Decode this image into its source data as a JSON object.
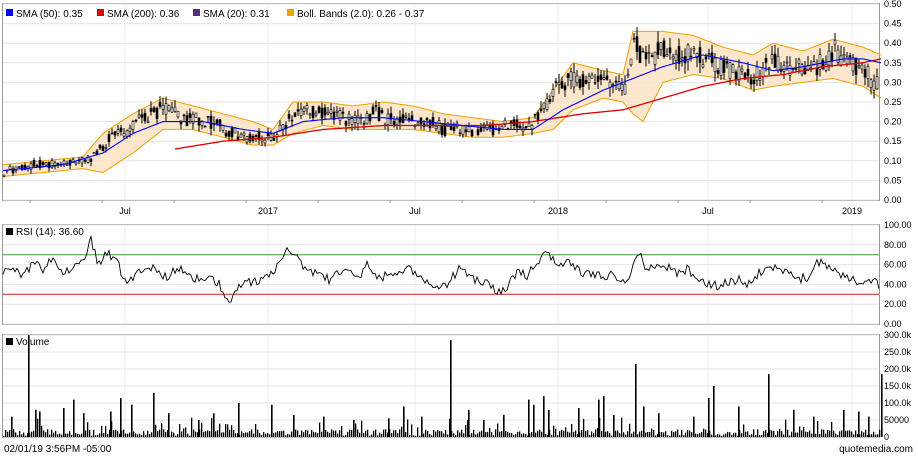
{
  "chart_data": [
    {
      "type": "candlestick",
      "panel": "price",
      "legend": [
        {
          "label": "SMA (50): 0.35",
          "color": "#0000ff"
        },
        {
          "label": "SMA (200): 0.36",
          "color": "#dd0000"
        },
        {
          "label": "SMA (20): 0.31",
          "color": "#5a2d82"
        },
        {
          "label": "Boll. Bands (2.0): 0.26 - 0.37",
          "color": "#f0a000"
        }
      ],
      "ylim": [
        0,
        0.5
      ],
      "yticks": [
        "0.50",
        "0.45",
        "0.40",
        "0.35",
        "0.30",
        "0.25",
        "0.20",
        "0.15",
        "0.10",
        "0.05",
        "0.00"
      ],
      "xticks": [
        "Jul",
        "2017",
        "Jul",
        "2018",
        "Jul",
        "2019"
      ],
      "grid": true,
      "price_path": [
        [
          0,
          0.07
        ],
        [
          15,
          0.085
        ],
        [
          30,
          0.09
        ],
        [
          45,
          0.09
        ],
        [
          60,
          0.1
        ],
        [
          75,
          0.1
        ],
        [
          90,
          0.11
        ],
        [
          100,
          0.14
        ],
        [
          110,
          0.17
        ],
        [
          120,
          0.17
        ],
        [
          130,
          0.19
        ],
        [
          140,
          0.21
        ],
        [
          150,
          0.22
        ],
        [
          160,
          0.24
        ],
        [
          170,
          0.22
        ],
        [
          180,
          0.2
        ],
        [
          190,
          0.21
        ],
        [
          200,
          0.2
        ],
        [
          210,
          0.2
        ],
        [
          220,
          0.18
        ],
        [
          230,
          0.17
        ],
        [
          240,
          0.16
        ],
        [
          250,
          0.16
        ],
        [
          260,
          0.16
        ],
        [
          270,
          0.16
        ],
        [
          280,
          0.19
        ],
        [
          290,
          0.22
        ],
        [
          300,
          0.24
        ],
        [
          310,
          0.22
        ],
        [
          320,
          0.22
        ],
        [
          330,
          0.21
        ],
        [
          340,
          0.21
        ],
        [
          350,
          0.2
        ],
        [
          360,
          0.2
        ],
        [
          370,
          0.23
        ],
        [
          380,
          0.21
        ],
        [
          390,
          0.2
        ],
        [
          400,
          0.21
        ],
        [
          410,
          0.2
        ],
        [
          420,
          0.2
        ],
        [
          430,
          0.2
        ],
        [
          440,
          0.18
        ],
        [
          450,
          0.18
        ],
        [
          460,
          0.18
        ],
        [
          470,
          0.18
        ],
        [
          480,
          0.18
        ],
        [
          490,
          0.18
        ],
        [
          500,
          0.19
        ],
        [
          510,
          0.19
        ],
        [
          520,
          0.19
        ],
        [
          530,
          0.2
        ],
        [
          540,
          0.24
        ],
        [
          550,
          0.28
        ],
        [
          560,
          0.3
        ],
        [
          570,
          0.31
        ],
        [
          580,
          0.31
        ],
        [
          590,
          0.3
        ],
        [
          600,
          0.3
        ],
        [
          610,
          0.29
        ],
        [
          620,
          0.28
        ],
        [
          630,
          0.4
        ],
        [
          640,
          0.36
        ],
        [
          650,
          0.37
        ],
        [
          660,
          0.39
        ],
        [
          670,
          0.38
        ],
        [
          680,
          0.37
        ],
        [
          690,
          0.38
        ],
        [
          700,
          0.35
        ],
        [
          710,
          0.35
        ],
        [
          720,
          0.34
        ],
        [
          730,
          0.33
        ],
        [
          740,
          0.32
        ],
        [
          750,
          0.31
        ],
        [
          760,
          0.33
        ],
        [
          770,
          0.36
        ],
        [
          780,
          0.35
        ],
        [
          790,
          0.34
        ],
        [
          800,
          0.34
        ],
        [
          810,
          0.34
        ],
        [
          820,
          0.35
        ],
        [
          830,
          0.39
        ],
        [
          840,
          0.36
        ],
        [
          850,
          0.35
        ],
        [
          860,
          0.33
        ],
        [
          870,
          0.3
        ],
        [
          878,
          0.28
        ]
      ],
      "sma50_path": [
        [
          0,
          0.075
        ],
        [
          60,
          0.09
        ],
        [
          100,
          0.12
        ],
        [
          130,
          0.17
        ],
        [
          160,
          0.2
        ],
        [
          200,
          0.2
        ],
        [
          240,
          0.18
        ],
        [
          270,
          0.17
        ],
        [
          300,
          0.2
        ],
        [
          340,
          0.21
        ],
        [
          380,
          0.21
        ],
        [
          420,
          0.2
        ],
        [
          460,
          0.19
        ],
        [
          500,
          0.18
        ],
        [
          530,
          0.18
        ],
        [
          560,
          0.23
        ],
        [
          600,
          0.28
        ],
        [
          630,
          0.31
        ],
        [
          660,
          0.34
        ],
        [
          700,
          0.37
        ],
        [
          740,
          0.35
        ],
        [
          770,
          0.33
        ],
        [
          800,
          0.34
        ],
        [
          840,
          0.36
        ],
        [
          860,
          0.36
        ],
        [
          878,
          0.35
        ]
      ],
      "sma200_path": [
        [
          172,
          0.13
        ],
        [
          220,
          0.15
        ],
        [
          270,
          0.16
        ],
        [
          320,
          0.18
        ],
        [
          380,
          0.19
        ],
        [
          430,
          0.19
        ],
        [
          480,
          0.19
        ],
        [
          530,
          0.2
        ],
        [
          580,
          0.22
        ],
        [
          620,
          0.23
        ],
        [
          660,
          0.26
        ],
        [
          700,
          0.29
        ],
        [
          740,
          0.31
        ],
        [
          780,
          0.32
        ],
        [
          820,
          0.34
        ],
        [
          860,
          0.35
        ],
        [
          878,
          0.36
        ]
      ],
      "boll_upper_path": [
        [
          0,
          0.09
        ],
        [
          40,
          0.1
        ],
        [
          80,
          0.11
        ],
        [
          100,
          0.17
        ],
        [
          130,
          0.22
        ],
        [
          160,
          0.26
        ],
        [
          190,
          0.24
        ],
        [
          220,
          0.22
        ],
        [
          250,
          0.2
        ],
        [
          270,
          0.18
        ],
        [
          290,
          0.25
        ],
        [
          320,
          0.25
        ],
        [
          350,
          0.24
        ],
        [
          380,
          0.25
        ],
        [
          410,
          0.24
        ],
        [
          440,
          0.22
        ],
        [
          470,
          0.21
        ],
        [
          500,
          0.2
        ],
        [
          530,
          0.21
        ],
        [
          550,
          0.28
        ],
        [
          570,
          0.35
        ],
        [
          600,
          0.33
        ],
        [
          620,
          0.32
        ],
        [
          630,
          0.43
        ],
        [
          660,
          0.43
        ],
        [
          690,
          0.42
        ],
        [
          720,
          0.39
        ],
        [
          750,
          0.37
        ],
        [
          770,
          0.4
        ],
        [
          800,
          0.38
        ],
        [
          830,
          0.41
        ],
        [
          860,
          0.39
        ],
        [
          878,
          0.37
        ]
      ],
      "boll_lower_path": [
        [
          0,
          0.06
        ],
        [
          40,
          0.07
        ],
        [
          80,
          0.08
        ],
        [
          100,
          0.07
        ],
        [
          130,
          0.12
        ],
        [
          160,
          0.18
        ],
        [
          190,
          0.18
        ],
        [
          220,
          0.16
        ],
        [
          250,
          0.14
        ],
        [
          270,
          0.14
        ],
        [
          290,
          0.17
        ],
        [
          320,
          0.19
        ],
        [
          350,
          0.18
        ],
        [
          380,
          0.18
        ],
        [
          410,
          0.18
        ],
        [
          440,
          0.17
        ],
        [
          470,
          0.16
        ],
        [
          500,
          0.16
        ],
        [
          530,
          0.17
        ],
        [
          550,
          0.18
        ],
        [
          570,
          0.23
        ],
        [
          600,
          0.26
        ],
        [
          620,
          0.25
        ],
        [
          630,
          0.22
        ],
        [
          640,
          0.2
        ],
        [
          660,
          0.3
        ],
        [
          690,
          0.32
        ],
        [
          720,
          0.31
        ],
        [
          750,
          0.28
        ],
        [
          770,
          0.29
        ],
        [
          800,
          0.3
        ],
        [
          830,
          0.31
        ],
        [
          860,
          0.29
        ],
        [
          878,
          0.26
        ]
      ]
    },
    {
      "type": "line",
      "panel": "rsi",
      "legend": [
        {
          "label": "RSI (14): 36.60",
          "color": "#000000"
        }
      ],
      "ylim": [
        0,
        100
      ],
      "yticks": [
        "100.00",
        "80.00",
        "60.00",
        "40.00",
        "20.00",
        "0.00"
      ],
      "overbought": 70,
      "oversold": 30,
      "rsi_path": [
        [
          0,
          55
        ],
        [
          10,
          60
        ],
        [
          20,
          48
        ],
        [
          30,
          62
        ],
        [
          40,
          55
        ],
        [
          50,
          66
        ],
        [
          60,
          50
        ],
        [
          70,
          60
        ],
        [
          80,
          65
        ],
        [
          88,
          87
        ],
        [
          95,
          62
        ],
        [
          105,
          72
        ],
        [
          115,
          60
        ],
        [
          125,
          40
        ],
        [
          135,
          55
        ],
        [
          145,
          60
        ],
        [
          155,
          52
        ],
        [
          165,
          48
        ],
        [
          175,
          55
        ],
        [
          185,
          52
        ],
        [
          195,
          45
        ],
        [
          205,
          45
        ],
        [
          215,
          42
        ],
        [
          225,
          22
        ],
        [
          235,
          35
        ],
        [
          245,
          45
        ],
        [
          255,
          40
        ],
        [
          265,
          48
        ],
        [
          275,
          60
        ],
        [
          285,
          78
        ],
        [
          295,
          65
        ],
        [
          305,
          50
        ],
        [
          315,
          55
        ],
        [
          325,
          45
        ],
        [
          335,
          50
        ],
        [
          345,
          55
        ],
        [
          355,
          48
        ],
        [
          365,
          60
        ],
        [
          375,
          45
        ],
        [
          385,
          52
        ],
        [
          395,
          50
        ],
        [
          405,
          55
        ],
        [
          415,
          48
        ],
        [
          425,
          40
        ],
        [
          435,
          38
        ],
        [
          445,
          40
        ],
        [
          455,
          55
        ],
        [
          465,
          50
        ],
        [
          475,
          42
        ],
        [
          485,
          40
        ],
        [
          495,
          32
        ],
        [
          505,
          38
        ],
        [
          515,
          55
        ],
        [
          525,
          48
        ],
        [
          535,
          65
        ],
        [
          545,
          70
        ],
        [
          555,
          60
        ],
        [
          565,
          62
        ],
        [
          575,
          55
        ],
        [
          585,
          50
        ],
        [
          595,
          48
        ],
        [
          605,
          50
        ],
        [
          615,
          45
        ],
        [
          625,
          40
        ],
        [
          635,
          72
        ],
        [
          645,
          55
        ],
        [
          655,
          60
        ],
        [
          665,
          58
        ],
        [
          675,
          50
        ],
        [
          685,
          55
        ],
        [
          695,
          45
        ],
        [
          705,
          40
        ],
        [
          715,
          38
        ],
        [
          725,
          42
        ],
        [
          735,
          45
        ],
        [
          745,
          40
        ],
        [
          755,
          50
        ],
        [
          765,
          62
        ],
        [
          775,
          55
        ],
        [
          785,
          50
        ],
        [
          795,
          45
        ],
        [
          805,
          48
        ],
        [
          815,
          62
        ],
        [
          825,
          58
        ],
        [
          835,
          52
        ],
        [
          845,
          48
        ],
        [
          855,
          40
        ],
        [
          865,
          42
        ],
        [
          872,
          45
        ],
        [
          878,
          36
        ]
      ]
    },
    {
      "type": "bar",
      "panel": "volume",
      "legend": [
        {
          "label": "Volume",
          "color": "#000000"
        }
      ],
      "ylim": [
        0,
        300000
      ],
      "yticks": [
        "300.0k",
        "250.0k",
        "200.0k",
        "150.0k",
        "100.0k",
        "50000",
        "0"
      ],
      "spikes": [
        [
          8,
          60000
        ],
        [
          25,
          300000
        ],
        [
          32,
          80000
        ],
        [
          36,
          75000
        ],
        [
          60,
          85000
        ],
        [
          70,
          110000
        ],
        [
          80,
          70000
        ],
        [
          107,
          75000
        ],
        [
          117,
          115000
        ],
        [
          128,
          95000
        ],
        [
          150,
          130000
        ],
        [
          165,
          70000
        ],
        [
          195,
          50000
        ],
        [
          210,
          70000
        ],
        [
          235,
          100000
        ],
        [
          268,
          95000
        ],
        [
          290,
          65000
        ],
        [
          320,
          60000
        ],
        [
          350,
          50000
        ],
        [
          385,
          55000
        ],
        [
          400,
          90000
        ],
        [
          418,
          60000
        ],
        [
          447,
          285000
        ],
        [
          465,
          80000
        ],
        [
          480,
          50000
        ],
        [
          500,
          65000
        ],
        [
          525,
          110000
        ],
        [
          530,
          95000
        ],
        [
          540,
          120000
        ],
        [
          545,
          80000
        ],
        [
          575,
          85000
        ],
        [
          595,
          110000
        ],
        [
          600,
          120000
        ],
        [
          610,
          65000
        ],
        [
          632,
          215000
        ],
        [
          640,
          90000
        ],
        [
          655,
          70000
        ],
        [
          690,
          60000
        ],
        [
          705,
          115000
        ],
        [
          710,
          150000
        ],
        [
          735,
          90000
        ],
        [
          765,
          185000
        ],
        [
          790,
          80000
        ],
        [
          810,
          60000
        ],
        [
          840,
          80000
        ],
        [
          855,
          75000
        ],
        [
          865,
          60000
        ],
        [
          878,
          185000
        ]
      ],
      "base_volume": 12000
    }
  ],
  "footer": {
    "timestamp": "02/01/19 3:56PM -05:00",
    "brand": "quotemedia.com"
  }
}
